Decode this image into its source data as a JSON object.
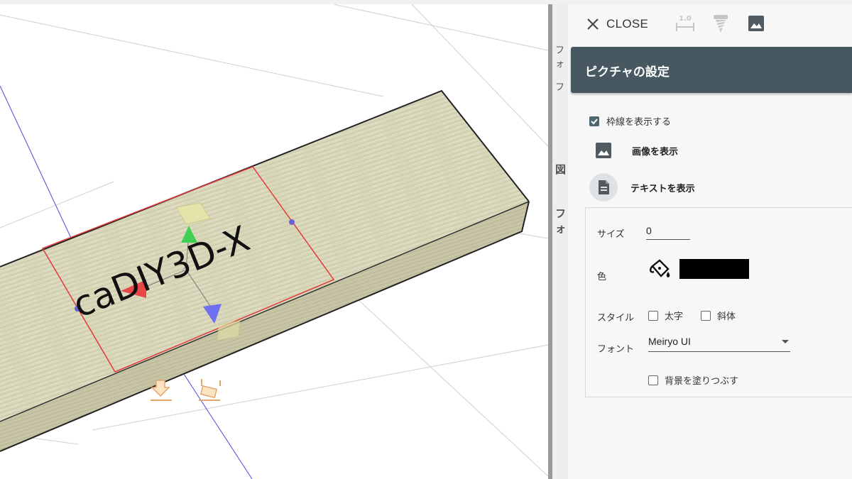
{
  "viewport": {
    "watermark_text": "caDIY3D-X",
    "colors": {
      "wood": "#d8d6b8",
      "frame": "#e23a3a",
      "axis_blue": "#4a4adf"
    }
  },
  "under_panel": {
    "fragments": [
      "フォ",
      "フ",
      "図",
      "フォ"
    ]
  },
  "toolbar": {
    "close_label": "CLOSE",
    "dimension_badge": "1.0",
    "icons": [
      "close-icon",
      "dimension-icon",
      "screw-icon",
      "picture-icon"
    ]
  },
  "panel": {
    "title": "ピクチャの設定",
    "show_border_label": "枠線を表示する",
    "show_border_checked": true,
    "show_image_label": "画像を表示",
    "show_text_label": "テキストを表示"
  },
  "text_settings": {
    "size_label": "サイズ",
    "size_value": "0",
    "color_label": "色",
    "color_value": "#000000",
    "style_label": "スタイル",
    "bold_label": "太字",
    "bold_checked": false,
    "italic_label": "斜体",
    "italic_checked": false,
    "font_label": "フォント",
    "font_value": "Meiryo UI",
    "fill_bg_label": "背景を塗りつぶす",
    "fill_bg_checked": false
  }
}
